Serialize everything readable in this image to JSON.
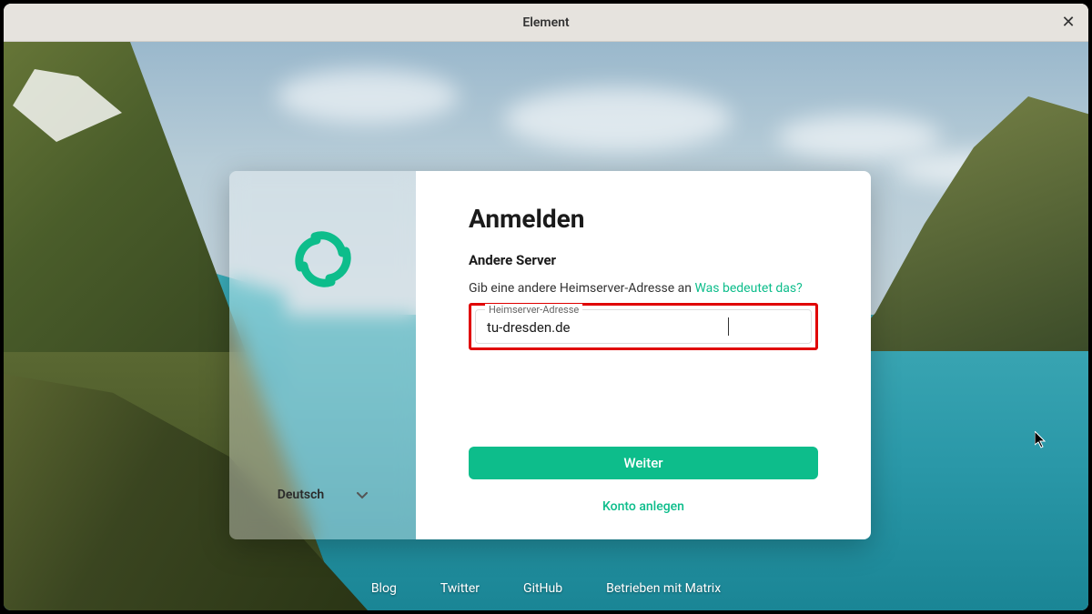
{
  "window": {
    "title": "Element"
  },
  "auth": {
    "heading": "Anmelden",
    "subheading": "Andere Server",
    "help_text": "Gib eine andere Heimserver-Adresse an ",
    "help_link": "Was bedeutet das?",
    "input_label": "Heimserver-Adresse",
    "input_value": "tu-dresden.de",
    "continue_button": "Weiter",
    "create_account": "Konto anlegen"
  },
  "language": {
    "selected": "Deutsch"
  },
  "footer": {
    "blog": "Blog",
    "twitter": "Twitter",
    "github": "GitHub",
    "powered": "Betrieben mit Matrix"
  },
  "colors": {
    "accent": "#0dbd8b",
    "highlight_border": "#e00000"
  }
}
